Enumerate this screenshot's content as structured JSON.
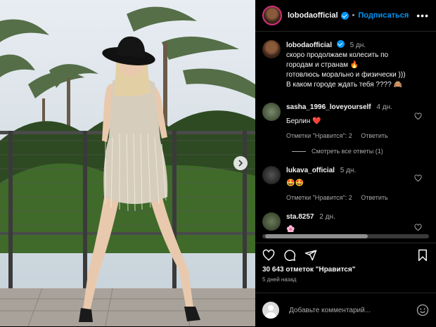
{
  "header": {
    "username": "lobodaofficial",
    "separator": "•",
    "follow_label": "Подписаться",
    "more_label": "•••"
  },
  "caption": {
    "username": "lobodaofficial",
    "time": "5 дн.",
    "lines": [
      "скоро продолжаем колесить по",
      "городам и странам 🔥",
      "готовлюсь морально и физически )))",
      "В каком городе ждать тебя ???? 🙈"
    ]
  },
  "comments": [
    {
      "user": "sasha_1996_loveyourself",
      "time": "4 дн.",
      "text": "Берлин ❤️",
      "likes": "Отметки \"Нравится\": 2",
      "reply": "Ответить"
    },
    {
      "user": "lukava_official",
      "time": "5 дн.",
      "text": "🤩🤩",
      "likes": "Отметки \"Нравится\": 2",
      "reply": "Ответить"
    },
    {
      "user": "sta.8257",
      "time": "2 дн.",
      "text": "🌸"
    }
  ],
  "view_replies": "Смотреть все ответы (1)",
  "likes_count": "30 643 отметок \"Нравится\"",
  "date": "5 дней назад",
  "add_comment_placeholder": "Добавьте комментарий...",
  "colors": {
    "accent": "#0095f6",
    "background": "#000000",
    "muted": "#a8a8a8"
  },
  "icons": [
    "heart-icon",
    "comment-icon",
    "share-icon",
    "bookmark-icon",
    "emoji-icon",
    "chevron-right-icon",
    "verified-icon",
    "more-icon"
  ]
}
